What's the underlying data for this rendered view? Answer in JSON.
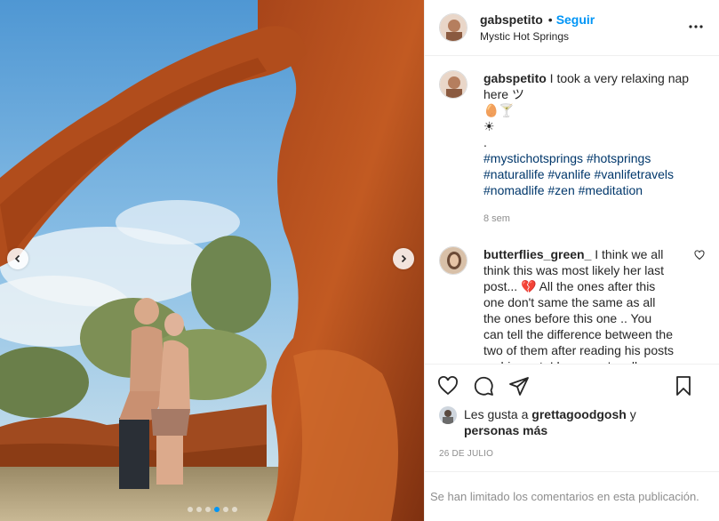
{
  "header": {
    "username": "gabspetito",
    "separator": "•",
    "follow_label": "Seguir",
    "location": "Mystic Hot Springs"
  },
  "caption": {
    "username": "gabspetito",
    "text_lines": [
      "I took a very relaxing nap",
      "here ツ",
      "🥚🍸",
      "☀",
      "."
    ],
    "hashtags_lines": [
      [
        "#mystichotsprings",
        "#hotsprings"
      ],
      [
        "#naturallife",
        "#vanlife",
        "#vanlifetravels"
      ],
      [
        "#nomadlife",
        "#zen",
        "#meditation"
      ]
    ],
    "age": "8 sem"
  },
  "comment": {
    "username": "butterflies_green_",
    "text": "I think we all think this was most likely her last post... 💔 All the ones after this one don't same the same as all the ones before this one .. You can tell the difference between the two of them after reading his posts on his acct. I hope you're all"
  },
  "likes": {
    "prefix": "Les gusta a",
    "user": "grettagoodgosh",
    "conj": "y",
    "others": "personas más"
  },
  "date": "26 DE JULIO",
  "comments_limited": "Se han limitado los comentarios en esta publicación.",
  "carousel": {
    "total": 6,
    "active_index": 3
  },
  "icons": {
    "prev": "chevron-left-icon",
    "next": "chevron-right-icon",
    "more": "more-options-icon",
    "like": "heart-icon",
    "comment": "comment-icon",
    "share": "share-icon",
    "save": "bookmark-icon",
    "comment_like": "small-heart-icon"
  },
  "colors": {
    "accent": "#0095f6",
    "link": "#00376b",
    "muted": "#8e8e8e",
    "border": "#efefef"
  }
}
